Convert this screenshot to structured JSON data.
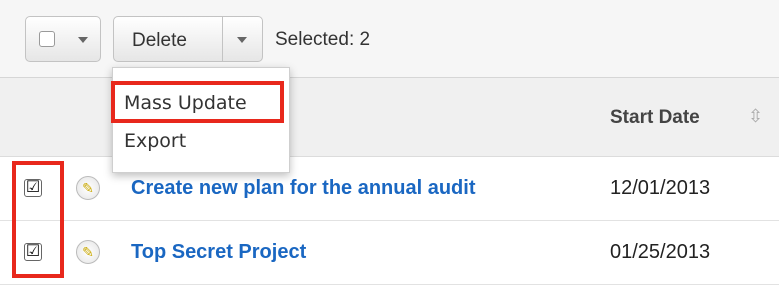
{
  "toolbar": {
    "delete_label": "Delete",
    "selected_text": "Selected: 2"
  },
  "menu": {
    "items": [
      {
        "label": "Mass Update",
        "highlighted": true
      },
      {
        "label": "Export",
        "highlighted": false
      }
    ]
  },
  "table": {
    "columns": [
      "Start Date"
    ],
    "rows": [
      {
        "name": "Create new plan for the annual audit",
        "start_date": "12/01/2013",
        "checked": true,
        "edit_icon": "pencil-icon"
      },
      {
        "name": "Top Secret Project",
        "start_date": "01/25/2013",
        "checked": true,
        "edit_icon": "pencil-icon"
      }
    ]
  },
  "icons": {
    "checkmark": "☑",
    "sort": "⇳"
  },
  "colors": {
    "link": "#1a67c2",
    "highlight": "#e8281c"
  }
}
